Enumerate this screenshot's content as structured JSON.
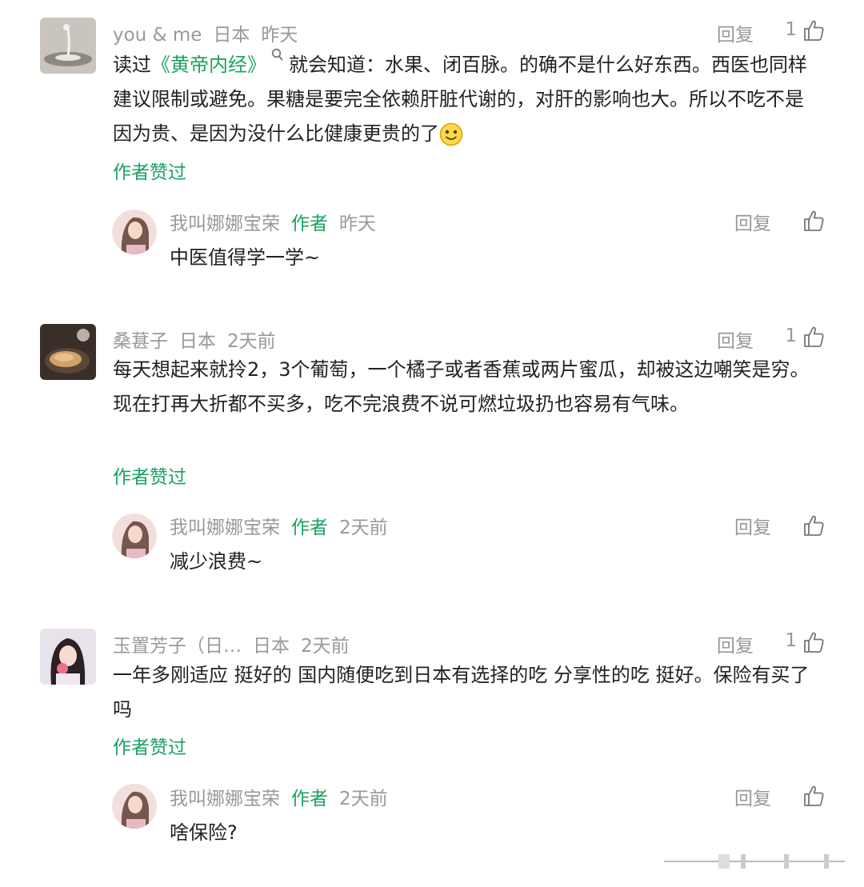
{
  "comments": [
    {
      "user": "you & me",
      "location": "日本",
      "time": "昨天",
      "reply_label": "回复",
      "likes": "1",
      "text_before": "读过",
      "link_text": "《黄帝内经》",
      "text_after": "就会知道：水果、闭百脉。的确不是什么好东西。西医也同样建议限制或避免。果糖是要完全依赖肝脏代谢的，对肝的影响也大。所以不吃不是因为贵、是因为没什么比健康更贵的了",
      "liked_by_author": "作者赞过",
      "reply": {
        "user": "我叫娜娜宝荣",
        "author_tag": "作者",
        "time": "昨天",
        "reply_label": "回复",
        "text": "中医值得学一学~"
      }
    },
    {
      "user": "桑葚子",
      "location": "日本",
      "time": "2天前",
      "reply_label": "回复",
      "likes": "1",
      "text": "每天想起来就拎2，3个葡萄，一个橘子或者香蕉或两片蜜瓜，却被这边嘲笑是穷。现在打再大折都不买多，吃不完浪费不说可燃垃圾扔也容易有气味。",
      "liked_by_author": "作者赞过",
      "reply": {
        "user": "我叫娜娜宝荣",
        "author_tag": "作者",
        "time": "2天前",
        "reply_label": "回复",
        "text": "减少浪费~"
      }
    },
    {
      "user": "玉置芳子（日…",
      "location": "日本",
      "time": "2天前",
      "reply_label": "回复",
      "likes": "1",
      "text": "一年多刚适应 挺好的 国内随便吃到日本有选择的吃 分享性的吃 挺好。保险有买了吗",
      "liked_by_author": "作者赞过",
      "reply": {
        "user": "我叫娜娜宝荣",
        "author_tag": "作者",
        "time": "2天前",
        "reply_label": "回复",
        "text": "啥保险?"
      }
    }
  ],
  "colors": {
    "green": "#1aa260",
    "gray": "#999999",
    "text": "#222222"
  },
  "icons": [
    "thumb-up-icon",
    "search-icon",
    "smile-emoji-icon"
  ]
}
